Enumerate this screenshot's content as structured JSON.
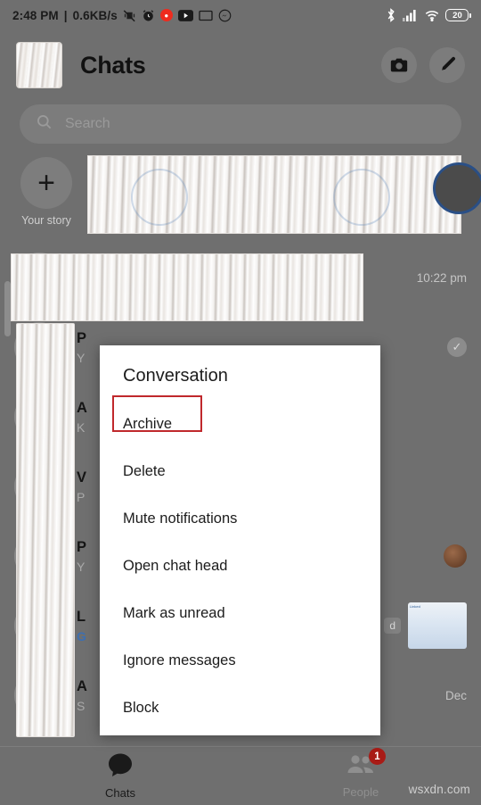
{
  "status_bar": {
    "time": "2:48 PM",
    "separator": "|",
    "network_speed": "0.6KB/s",
    "left_icons": [
      "vibrate-off-icon",
      "alarm-clock-icon",
      "record-dot-icon",
      "youtube-icon",
      "screencast-icon",
      "messenger-icon"
    ],
    "right_icons": [
      "bluetooth-icon",
      "cellular-signal-icon",
      "wifi-icon"
    ],
    "battery_level": "20"
  },
  "header": {
    "title": "Chats",
    "avatar": "profile-avatar",
    "camera_label": "camera-icon",
    "compose_label": "compose-icon"
  },
  "search": {
    "placeholder": "Search",
    "icon": "search-icon"
  },
  "stories": {
    "add_label": "Your story",
    "add_icon": "plus-icon"
  },
  "chat_list": [
    {
      "name": "",
      "snippet": "",
      "time": "10:22 pm",
      "unread": false,
      "trailing": "none"
    },
    {
      "name": "P",
      "snippet": "Y",
      "time": "",
      "unread": false,
      "trailing": "check"
    },
    {
      "name": "A",
      "snippet": "K",
      "time": "",
      "unread": false,
      "trailing": "none"
    },
    {
      "name": "V",
      "snippet": "P",
      "time": "",
      "unread": false,
      "trailing": "none"
    },
    {
      "name": "P",
      "snippet": "Y",
      "time": "",
      "unread": false,
      "trailing": "avatar"
    },
    {
      "name": "L",
      "snippet": "G",
      "time": "",
      "unread": true,
      "trailing": "thumb",
      "badge": "d"
    },
    {
      "name": "A",
      "snippet": "S",
      "time": "Dec",
      "unread": false,
      "trailing": "none"
    }
  ],
  "dialog": {
    "title": "Conversation",
    "items": [
      {
        "label": "Archive",
        "highlighted": true
      },
      {
        "label": "Delete",
        "highlighted": false
      },
      {
        "label": "Mute notifications",
        "highlighted": false
      },
      {
        "label": "Open chat head",
        "highlighted": false
      },
      {
        "label": "Mark as unread",
        "highlighted": false
      },
      {
        "label": "Ignore messages",
        "highlighted": false
      },
      {
        "label": "Block",
        "highlighted": false
      }
    ]
  },
  "bottom_nav": {
    "items": [
      {
        "label": "Chats",
        "icon": "chat-bubble-icon",
        "active": true,
        "badge": ""
      },
      {
        "label": "People",
        "icon": "people-icon",
        "active": false,
        "badge": "1"
      }
    ]
  },
  "watermark": "wsxdn.com",
  "colors": {
    "highlight_red": "#c0282c",
    "badge_red": "#a81b16",
    "dialog_bg": "#ffffff",
    "dim_overlay": "#6f6f6f",
    "unread_blue": "#3e6fb0"
  }
}
